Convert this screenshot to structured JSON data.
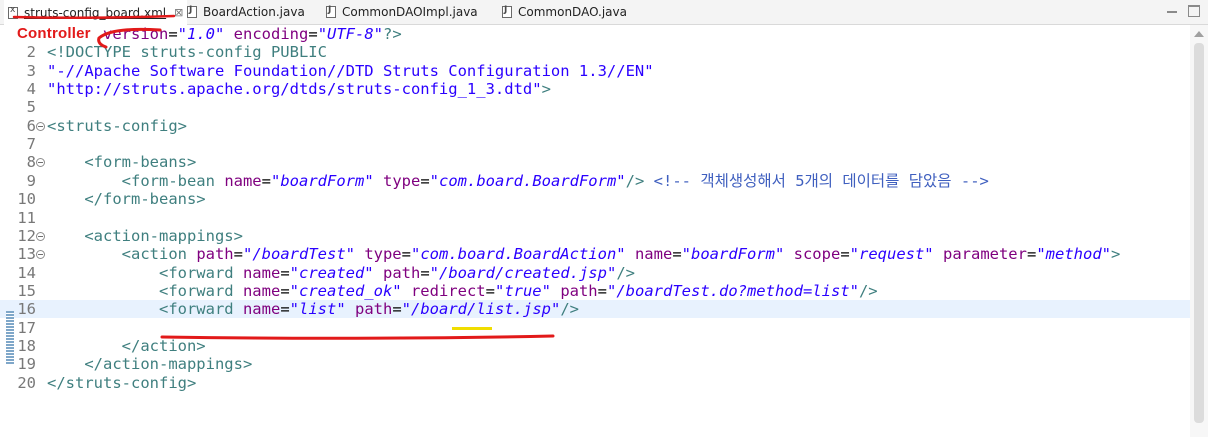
{
  "tabs": [
    {
      "label": "struts-config_board.xml",
      "icon": "xml-file-icon",
      "active": true,
      "closable": true
    },
    {
      "label": "BoardAction.java",
      "icon": "java-file-icon"
    },
    {
      "label": "CommonDAOImpl.java",
      "icon": "java-file-icon"
    },
    {
      "label": "CommonDAO.java",
      "icon": "java-file-icon"
    }
  ],
  "close_glyph": "⊠",
  "annotation": {
    "label": "Controller",
    "color": "#e21a1a",
    "highlight": "#f0dd00"
  },
  "current_line": 16,
  "lines": [
    {
      "n": "1",
      "tokens": [
        [
          "t-dt",
          "<?"
        ],
        [
          "t-tag",
          "xml"
        ],
        [
          "t-attr",
          " version"
        ],
        [
          "t-ns",
          "="
        ],
        [
          "t-val",
          "\"1.0\""
        ],
        [
          "t-attr",
          " encoding"
        ],
        [
          "t-ns",
          "="
        ],
        [
          "t-val",
          "\"UTF-8\""
        ],
        [
          "t-dt",
          "?>"
        ]
      ]
    },
    {
      "n": "2",
      "tokens": [
        [
          "t-dt",
          "<!DOCTYPE struts-config PUBLIC"
        ]
      ]
    },
    {
      "n": "3",
      "tokens": [
        [
          "t-str",
          "\"-//Apache Software Foundation//DTD Struts Configuration 1.3//EN\""
        ]
      ]
    },
    {
      "n": "4",
      "tokens": [
        [
          "t-str",
          "\"http://struts.apache.org/dtds/struts-config_1_3.dtd\""
        ],
        [
          "t-dt",
          ">"
        ]
      ]
    },
    {
      "n": "5",
      "tokens": []
    },
    {
      "n": "6",
      "fold": true,
      "tokens": [
        [
          "t-tag",
          "<struts-config>"
        ]
      ]
    },
    {
      "n": "7",
      "tokens": []
    },
    {
      "n": "8",
      "fold": true,
      "tokens": [
        [
          "t-ns",
          "    "
        ],
        [
          "t-tag",
          "<form-beans>"
        ]
      ]
    },
    {
      "n": "9",
      "tokens": [
        [
          "t-ns",
          "        "
        ],
        [
          "t-tag",
          "<form-bean"
        ],
        [
          "t-attr",
          " name"
        ],
        [
          "t-ns",
          "="
        ],
        [
          "t-val",
          "\"boardForm\""
        ],
        [
          "t-attr",
          " type"
        ],
        [
          "t-ns",
          "="
        ],
        [
          "t-val",
          "\"com.board.BoardForm\""
        ],
        [
          "t-tag",
          "/>"
        ],
        [
          "t-ns",
          " "
        ],
        [
          "t-cmt",
          "<!-- 객체생성해서 5개의 데이터를 담았음 -->"
        ]
      ]
    },
    {
      "n": "10",
      "tokens": [
        [
          "t-ns",
          "    "
        ],
        [
          "t-tag",
          "</form-beans>"
        ]
      ]
    },
    {
      "n": "11",
      "tokens": []
    },
    {
      "n": "12",
      "fold": true,
      "tokens": [
        [
          "t-ns",
          "    "
        ],
        [
          "t-tag",
          "<action-mappings>"
        ]
      ]
    },
    {
      "n": "13",
      "fold": true,
      "tokens": [
        [
          "t-ns",
          "        "
        ],
        [
          "t-tag",
          "<action"
        ],
        [
          "t-attr",
          " path"
        ],
        [
          "t-ns",
          "="
        ],
        [
          "t-val",
          "\"/boardTest\""
        ],
        [
          "t-attr",
          " type"
        ],
        [
          "t-ns",
          "="
        ],
        [
          "t-val",
          "\"com.board.BoardAction\""
        ],
        [
          "t-attr",
          " name"
        ],
        [
          "t-ns",
          "="
        ],
        [
          "t-val",
          "\"boardForm\""
        ],
        [
          "t-attr",
          " scope"
        ],
        [
          "t-ns",
          "="
        ],
        [
          "t-val",
          "\"request\""
        ],
        [
          "t-attr",
          " parameter"
        ],
        [
          "t-ns",
          "="
        ],
        [
          "t-val",
          "\"method\""
        ],
        [
          "t-tag",
          ">"
        ]
      ]
    },
    {
      "n": "14",
      "tokens": [
        [
          "t-ns",
          "            "
        ],
        [
          "t-tag",
          "<forward"
        ],
        [
          "t-attr",
          " name"
        ],
        [
          "t-ns",
          "="
        ],
        [
          "t-val",
          "\"created\""
        ],
        [
          "t-attr",
          " path"
        ],
        [
          "t-ns",
          "="
        ],
        [
          "t-val",
          "\"/board/created.jsp\""
        ],
        [
          "t-tag",
          "/>"
        ]
      ]
    },
    {
      "n": "15",
      "tokens": [
        [
          "t-ns",
          "            "
        ],
        [
          "t-tag",
          "<forward"
        ],
        [
          "t-attr",
          " name"
        ],
        [
          "t-ns",
          "="
        ],
        [
          "t-val",
          "\"created_ok\""
        ],
        [
          "t-attr",
          " redirect"
        ],
        [
          "t-ns",
          "="
        ],
        [
          "t-val",
          "\"true\""
        ],
        [
          "t-attr",
          " path"
        ],
        [
          "t-ns",
          "="
        ],
        [
          "t-val",
          "\"/boardTest.do?method=list\""
        ],
        [
          "t-tag",
          "/>"
        ]
      ]
    },
    {
      "n": "16",
      "tokens": [
        [
          "t-ns",
          "            "
        ],
        [
          "t-tag",
          "<forward"
        ],
        [
          "t-attr",
          " name"
        ],
        [
          "t-ns",
          "="
        ],
        [
          "t-val",
          "\"list\""
        ],
        [
          "t-attr",
          " path"
        ],
        [
          "t-ns",
          "="
        ],
        [
          "t-val",
          "\"/board/list.jsp\""
        ],
        [
          "t-tag",
          "/>"
        ]
      ]
    },
    {
      "n": "17",
      "tokens": []
    },
    {
      "n": "18",
      "tokens": [
        [
          "t-ns",
          "        "
        ],
        [
          "t-tag",
          "</action>"
        ]
      ]
    },
    {
      "n": "19",
      "tokens": [
        [
          "t-ns",
          "    "
        ],
        [
          "t-tag",
          "</action-mappings>"
        ]
      ]
    },
    {
      "n": "20",
      "tokens": [
        [
          "t-tag",
          "</struts-config>"
        ]
      ]
    }
  ]
}
